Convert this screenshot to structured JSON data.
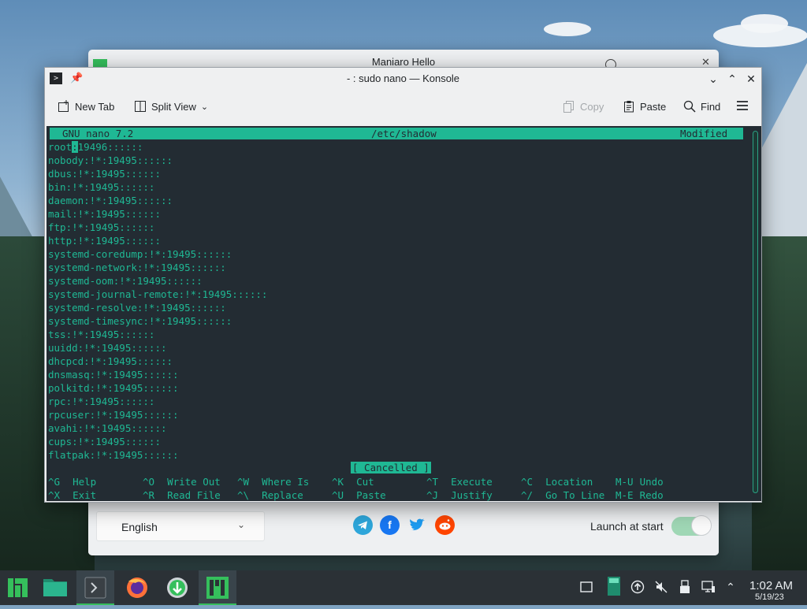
{
  "hello_window": {
    "title": "Maniaro Hello",
    "language": "English",
    "launch_at_start_label": "Launch at start",
    "launch_at_start": true,
    "social_icons": [
      "telegram-icon",
      "facebook-icon",
      "twitter-icon",
      "reddit-icon"
    ]
  },
  "konsole": {
    "title": "- : sudo nano — Konsole",
    "toolbar": {
      "new_tab": "New Tab",
      "split_view": "Split View",
      "copy": "Copy",
      "paste": "Paste",
      "find": "Find"
    }
  },
  "nano": {
    "version": "GNU nano 7.2",
    "filename": "/etc/shadow",
    "state": "Modified",
    "cursor_char": ":",
    "first_line_rest": "19496::::::",
    "first_line_head": "root",
    "lines": [
      "nobody:!*:19495::::::",
      "dbus:!*:19495::::::",
      "bin:!*:19495::::::",
      "daemon:!*:19495::::::",
      "mail:!*:19495::::::",
      "ftp:!*:19495::::::",
      "http:!*:19495::::::",
      "systemd-coredump:!*:19495::::::",
      "systemd-network:!*:19495::::::",
      "systemd-oom:!*:19495::::::",
      "systemd-journal-remote:!*:19495::::::",
      "systemd-resolve:!*:19495::::::",
      "systemd-timesync:!*:19495::::::",
      "tss:!*:19495::::::",
      "uuidd:!*:19495::::::",
      "dhcpcd:!*:19495::::::",
      "dnsmasq:!*:19495::::::",
      "polkitd:!*:19495::::::",
      "rpc:!*:19495::::::",
      "rpcuser:!*:19495::::::",
      "avahi:!*:19495::::::",
      "cups:!*:19495::::::",
      "flatpak:!*:19495::::::"
    ],
    "status_message": "[ Cancelled ]",
    "shortcuts": [
      {
        "key": "^G",
        "label": "Help"
      },
      {
        "key": "^O",
        "label": "Write Out"
      },
      {
        "key": "^W",
        "label": "Where Is"
      },
      {
        "key": "^K",
        "label": "Cut"
      },
      {
        "key": "^T",
        "label": "Execute"
      },
      {
        "key": "^C",
        "label": "Location"
      },
      {
        "key": "M-U",
        "label": "Undo"
      },
      {
        "key": "^X",
        "label": "Exit"
      },
      {
        "key": "^R",
        "label": "Read File"
      },
      {
        "key": "^\\",
        "label": "Replace"
      },
      {
        "key": "^U",
        "label": "Paste"
      },
      {
        "key": "^J",
        "label": "Justify"
      },
      {
        "key": "^/",
        "label": "Go To Line"
      },
      {
        "key": "M-E",
        "label": "Redo"
      }
    ]
  },
  "taskbar": {
    "tasks": [
      "manjaro-menu-icon",
      "file-manager-icon",
      "konsole-icon",
      "firefox-icon",
      "update-icon",
      "manjaro-hello-icon"
    ],
    "tray": [
      "show-desktop-icon",
      "clipboard-icon",
      "updates-tray-icon",
      "mute-icon",
      "usb-icon",
      "network-icon",
      "expand-tray-icon"
    ],
    "time": "1:02 AM",
    "date": "5/19/23"
  },
  "colors": {
    "terminal_bg": "#232c33",
    "terminal_fg": "#1fb894",
    "manjaro_green": "#35bf5c",
    "taskbar_bg": "#2b3136"
  }
}
